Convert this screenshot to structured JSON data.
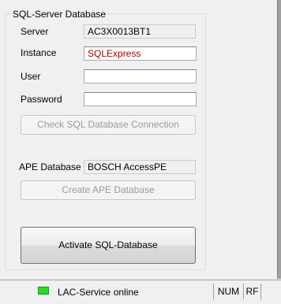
{
  "group": {
    "title": "SQL-Server Database"
  },
  "server": {
    "label": "Server",
    "value": "AC3X0013BT1"
  },
  "instance": {
    "label": "Instance",
    "value": "SQLExpress"
  },
  "user": {
    "label": "User",
    "value": ""
  },
  "password": {
    "label": "Password",
    "value": ""
  },
  "check_button": {
    "label": "Check SQL Database Connection"
  },
  "ape": {
    "label": "APE Database",
    "value": "BOSCH AccessPE"
  },
  "create_button": {
    "label": "Create APE Database"
  },
  "activate_button": {
    "label": "Activate SQL-Database"
  },
  "statusbar": {
    "service_text": "LAC-Service online",
    "service_status_color": "#22dd22",
    "num": "NUM",
    "rf": "RF"
  }
}
